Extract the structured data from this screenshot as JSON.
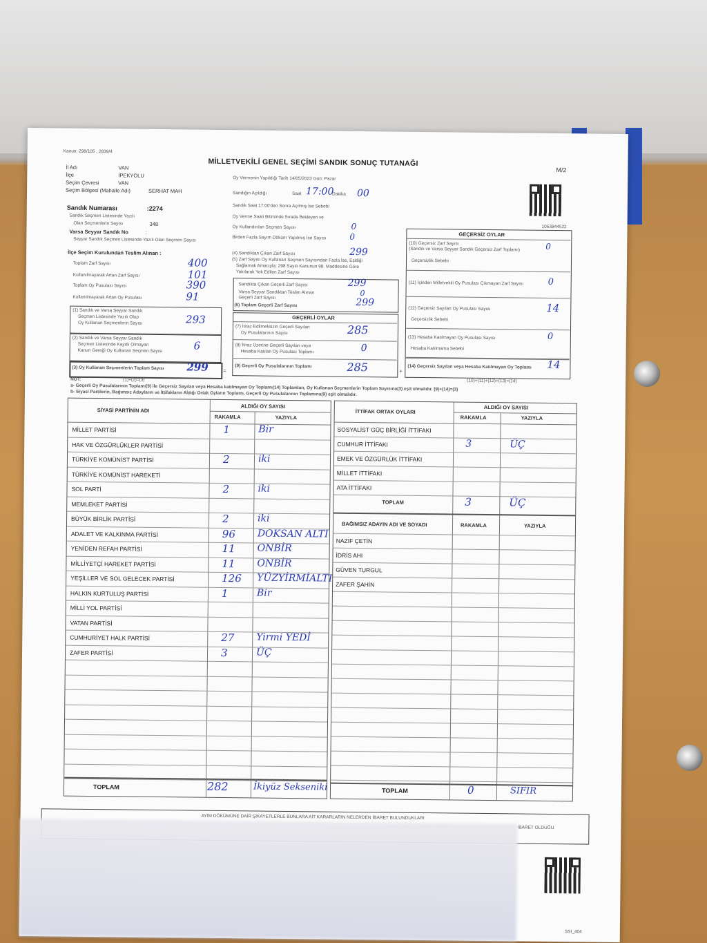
{
  "header": {
    "law_ref": "Kanun: 298/105 , 2839/4",
    "title": "MİLLETVEKİLİ GENEL SEÇİMİ SANDIK SONUÇ TUTANAĞI",
    "form_code": "M/2",
    "serial": "1063844522",
    "footer_code": "SSI_404"
  },
  "location": {
    "il_label": "İl Adı",
    "il": "VAN",
    "ilce_label": "İlçe",
    "ilce": "İPEKYOLU",
    "cevre_label": "Seçim Çevresi",
    "cevre": "VAN",
    "bolge_label": "Seçim Bölgesi (Mahalle Adı)",
    "bolge": "SERHAT MAH"
  },
  "ballot_box": {
    "number_label": "Sandık Numarası",
    "number": ":2274",
    "registered_label_1": "Sandık Seçmen Listesinde Yazılı",
    "registered_label_2": "Olan Seçmenlerin Sayısı",
    "registered": "348",
    "mobile_label": "Varsa Seyyar Sandık No",
    "mobile": ":",
    "mobile_voters_label": "Seyyar Sandık Seçmen Listesinde Yazılı Olan Seçmen Sayısı"
  },
  "vote_info": {
    "date_label": "Oy Vermenin Yapıldığı Tarih 14/05/2023   Gün: Pazar",
    "opening_label": "Sandığın Açıldığı",
    "saat_label": "Saat",
    "saat": "17:00",
    "dakika_label": "Dakika",
    "dakika": "00",
    "after17_label": "Sandık Saat 17:00'den Sonra Açılmış İse Sebebi",
    "queue_label_1": "Oy Verme Saati Bitiminde Sırada Bekleyen ve",
    "queue_label_2": "Oy Kullandırılan Seçmen Sayısı",
    "queue": "0",
    "recount_label": "Birden Fazla Sayım Döküm Yapılmış İse Sayısı",
    "recount": "0"
  },
  "received": {
    "title": "İlçe Seçim Kurulundan Teslim Alınan :",
    "rows": [
      {
        "label": "Toplam Zarf Sayısı",
        "value": "400"
      },
      {
        "label": "Kullanılmayarak Artan Zarf Sayısı",
        "value": "101"
      },
      {
        "label": "Toplam Oy Pusulası Sayısı",
        "value": "390"
      },
      {
        "label": "Kullanılmayarak Artan Oy Pusulası",
        "value": "91"
      }
    ]
  },
  "box1": {
    "label_1": "(1) Sandık ve Varsa Seyyar Sandık",
    "label_2": "Seçmen Listesinde Yazılı Olup",
    "label_3": "Oy Kullanan Seçmenlerin Sayısı",
    "value": "293"
  },
  "box2": {
    "label_1": "(2) Sandık ve Varsa Seyyar Sandık",
    "label_2": "Seçmen Listesinde Kayıtlı Olmayan",
    "label_3": "Kanun Gereği Oy Kullanan Seçmen Sayısı",
    "value": "6"
  },
  "box3": {
    "label": "(3) Oy Kullanan Seçmenlerin Toplam Sayısı",
    "value": "299"
  },
  "envelopes": {
    "r4_label": "(4) Sandıktan Çıkan Zarf Sayısı",
    "r4": "299",
    "r5_label_1": "(5) Zarf Sayısı Oy Kullanan Seçmen Sayısından Fazla İse, Eşitliği",
    "r5_label_2": "Sağlamak Amacıyla; 298 Sayılı Kanunun 98. Maddesine Göre",
    "r5_label_3": "Yakılarak Yok Edilen Zarf Sayısı",
    "valid_env_label": "Sandıkta Çıkan Geçerli Zarf Sayısı",
    "valid_env": "299",
    "mobile_env_label_1": "Varsa Seyyar Sandıktan Teslim Alınan",
    "mobile_env_label_2": "Geçerli Zarf Sayısı",
    "mobile_env": "0",
    "r6_label": "(6) Toplam Geçerli Zarf Sayısı",
    "r6": "299"
  },
  "valid_votes": {
    "title": "GEÇERLİ OYLAR",
    "r7_label_1": "(7) İtiraz Edilmeksizin Geçerli Sayılan",
    "r7_label_2": "Oy Pusulalarının Sayısı",
    "r7": "285",
    "r8_label_1": "(8) İtiraz Üzerine Geçerli Sayılan veya",
    "r8_label_2": "Hesaba Katılan Oy Pusulası Toplamı",
    "r8": "0",
    "r9_label": "(9) Geçerli Oy Pusulalarının Toplamı",
    "r9": "285",
    "formula": "(1)+(2)=(3)",
    "eq": "=",
    "plus": "+"
  },
  "invalid_votes": {
    "title": "GEÇERSİZ OYLAR",
    "r10_label_1": "(10) Geçersiz Zarf Sayısı",
    "r10_label_2": "(Sandık ve Varsa Seyyar Sandık Geçersiz Zarf Toplamı)",
    "r10": "0",
    "reason": "Geçersizlik Sebebi",
    "r11_label": "(11) İçinden Milletvekili Oy Pusulası Çıkmayan Zarf Sayısı",
    "r11": "0",
    "r12_label": "(12) Geçersiz Sayılan Oy Pusulası Sayısı",
    "r12": "14",
    "r13_label": "(13) Hesaba Katılmayan Oy Pusulası Sayısı",
    "r13_reason": "Hesaba Katılmama Sebebi",
    "r13": "0",
    "r14_label": "(14) Geçersiz Sayılan veya Hesaba Katılmayan Oy Toplamı",
    "r14": "14",
    "formula": "(10)+(11)+(12)+(13)=(14)"
  },
  "notes": {
    "title": "NOT:",
    "a": "a- Geçerli Oy Pusulalarının Toplamı(9) ile Geçersiz Sayılan veya Hesaba katılmayan Oy Toplamı(14) Toplamları, Oy Kullanan Seçmenlerin Toplam Sayısına(3) eşit olmalıdır. (9)+(14)=(3)",
    "b": "b- Siyasi Partilerin, Bağımsız Adayların ve İttifakların Aldığı Ortak Oyların Toplamı, Geçerli Oy Pusulalarının Toplamına(9) eşit olmalıdır."
  },
  "parties_table": {
    "col_name": "SİYASİ PARTİNİN ADI",
    "col_votes": "ALDIĞI OY SAYISI",
    "col_num": "RAKAMLA",
    "col_text": "YAZIYLA",
    "rows": [
      {
        "name": "MİLLET PARTİSİ",
        "num": "1",
        "text": "Bir"
      },
      {
        "name": "HAK VE ÖZGÜRLÜKLER PARTİSİ",
        "num": "",
        "text": ""
      },
      {
        "name": "TÜRKİYE KOMÜNİST PARTİSİ",
        "num": "2",
        "text": "iki"
      },
      {
        "name": "TÜRKİYE KOMÜNİST HAREKETİ",
        "num": "",
        "text": ""
      },
      {
        "name": "SOL PARTİ",
        "num": "2",
        "text": "iki"
      },
      {
        "name": "MEMLEKET PARTİSİ",
        "num": "",
        "text": ""
      },
      {
        "name": "BÜYÜK BİRLİK PARTİSİ",
        "num": "2",
        "text": "iki"
      },
      {
        "name": "ADALET VE KALKINMA PARTİSİ",
        "num": "96",
        "text": "DOKSAN ALTI"
      },
      {
        "name": "YENİDEN REFAH PARTİSİ",
        "num": "11",
        "text": "ONBİR"
      },
      {
        "name": "MİLLİYETÇİ HAREKET PARTİSİ",
        "num": "11",
        "text": "ONBİR"
      },
      {
        "name": "YEŞİLLER VE SOL GELECEK PARTİSİ",
        "num": "126",
        "text": "YÜZYİRMİALTI"
      },
      {
        "name": "HALKIN KURTULUŞ PARTİSİ",
        "num": "1",
        "text": "Bir"
      },
      {
        "name": "MİLLİ YOL PARTİSİ",
        "num": "",
        "text": ""
      },
      {
        "name": "VATAN PARTİSİ",
        "num": "",
        "text": ""
      },
      {
        "name": "CUMHURİYET HALK PARTİSİ",
        "num": "27",
        "text": "Yirmi YEDİ"
      },
      {
        "name": "ZAFER PARTİSİ",
        "num": "3",
        "text": "ÜÇ"
      }
    ],
    "total_label": "TOPLAM",
    "total_num": "282",
    "total_text": "İkiyüz Sekseniki"
  },
  "alliance_table": {
    "col_name": "İTTİFAK ORTAK OYLARI",
    "col_votes": "ALDIĞI OY SAYISI",
    "col_num": "RAKAMLA",
    "col_text": "YAZIYLA",
    "rows": [
      {
        "name": "SOSYALİST GÜÇ BİRLİĞİ İTTİFAKI",
        "num": "",
        "text": ""
      },
      {
        "name": "CUMHUR İTTİFAKI",
        "num": "3",
        "text": "ÜÇ"
      },
      {
        "name": "EMEK VE ÖZGÜRLÜK İTTİFAKI",
        "num": "",
        "text": ""
      },
      {
        "name": "MİLLET İTTİFAKI",
        "num": "",
        "text": ""
      },
      {
        "name": "ATA İTTİFAKI",
        "num": "",
        "text": ""
      }
    ],
    "total_label": "TOPLAM",
    "total_num": "3",
    "total_text": "ÜÇ"
  },
  "independent_table": {
    "col_name": "BAĞIMSIZ ADAYIN ADI VE SOYADI",
    "col_num": "RAKAMLA",
    "col_text": "YAZIYLA",
    "rows": [
      "NAZİF ÇETİN",
      "İDRİS AHI",
      "GÜVEN TURGUL",
      "ZAFER ŞAHİN"
    ],
    "total_label": "TOPLAM",
    "total_num": "0",
    "total_text": "SIFIR"
  },
  "complaints": {
    "text": "AYIM DÖKÜMÜNE DAİR ŞİKAYETLERLE BUNLARA AİT KARARLARIN NELERDEN İBARET BULUNDUKLARI",
    "text2": "İBARET OLDUĞU"
  }
}
